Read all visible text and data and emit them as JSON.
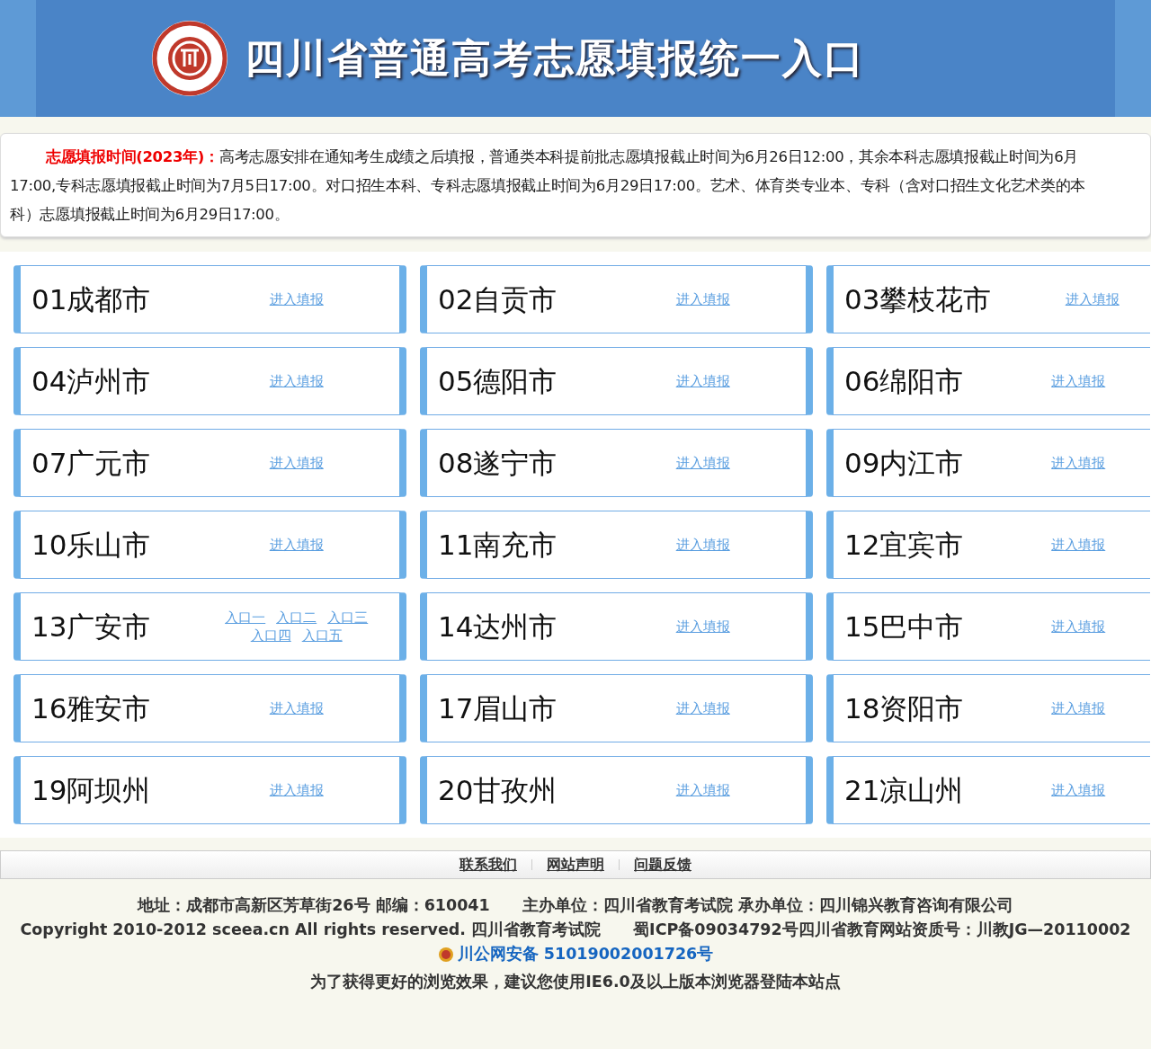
{
  "header": {
    "title": "四川省普通高考志愿填报统一入口"
  },
  "notice": {
    "label": "志愿填报时间(2023年)：",
    "lines": [
      "高考志愿安排在通知考生成绩之后填报，普通类本科提前批志愿填报截止时间为6月26日12:00，其余本科志愿填报截止时间为6月",
      "17:00,专科志愿填报截止时间为7月5日17:00。对口招生本科、专科志愿填报截止时间为6月29日17:00。艺术、体育类专业本、专科（含对口招生文化艺术类的本",
      "科）志愿填报截止时间为6月29日17:00。"
    ]
  },
  "regions": [
    {
      "name": "01成都市",
      "links": [
        "进入填报"
      ]
    },
    {
      "name": "02自贡市",
      "links": [
        "进入填报"
      ]
    },
    {
      "name": "03攀枝花市",
      "links": [
        "进入填报"
      ]
    },
    {
      "name": "04泸州市",
      "links": [
        "进入填报"
      ]
    },
    {
      "name": "05德阳市",
      "links": [
        "进入填报"
      ]
    },
    {
      "name": "06绵阳市",
      "links": [
        "进入填报"
      ]
    },
    {
      "name": "07广元市",
      "links": [
        "进入填报"
      ]
    },
    {
      "name": "08遂宁市",
      "links": [
        "进入填报"
      ]
    },
    {
      "name": "09内江市",
      "links": [
        "进入填报"
      ]
    },
    {
      "name": "10乐山市",
      "links": [
        "进入填报"
      ]
    },
    {
      "name": "11南充市",
      "links": [
        "进入填报"
      ]
    },
    {
      "name": "12宜宾市",
      "links": [
        "进入填报"
      ]
    },
    {
      "name": "13广安市",
      "links": [
        "入口一",
        "入口二",
        "入口三",
        "入口四",
        "入口五"
      ]
    },
    {
      "name": "14达州市",
      "links": [
        "进入填报"
      ]
    },
    {
      "name": "15巴中市",
      "links": [
        "进入填报"
      ]
    },
    {
      "name": "16雅安市",
      "links": [
        "进入填报"
      ]
    },
    {
      "name": "17眉山市",
      "links": [
        "进入填报"
      ]
    },
    {
      "name": "18资阳市",
      "links": [
        "进入填报"
      ]
    },
    {
      "name": "19阿坝州",
      "links": [
        "进入填报"
      ]
    },
    {
      "name": "20甘孜州",
      "links": [
        "进入填报"
      ]
    },
    {
      "name": "21凉山州",
      "links": [
        "进入填报"
      ]
    }
  ],
  "footer": {
    "links": [
      "联系我们",
      "网站声明",
      "问题反馈"
    ],
    "address": "地址：成都市高新区芳草街26号 邮编：610041　　主办单位：四川省教育考试院 承办单位：四川锦兴教育咨询有限公司",
    "copyright": "Copyright 2010-2012 sceea.cn All rights reserved. 四川省教育考试院　　蜀ICP备09034792号四川省教育网站资质号：川教JG—20110002",
    "police": "川公网安备 51019002001726号",
    "tip": "为了获得更好的浏览效果，建议您使用IE6.0及以上版本浏览器登陆本站点"
  }
}
